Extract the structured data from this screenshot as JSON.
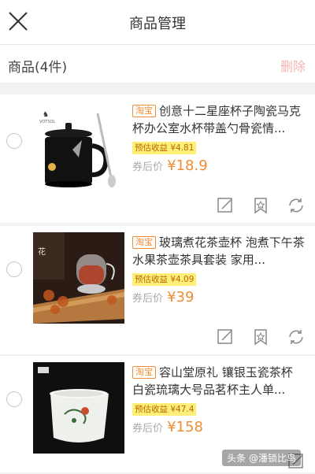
{
  "header": {
    "title": "商品管理"
  },
  "toolbar": {
    "count_label": "商品(4件)",
    "delete_label": "删除"
  },
  "products": [
    {
      "tag": "淘宝",
      "title": "创意十二星座杯子陶瓷马克杯办公室水杯带盖勺骨瓷情...",
      "earn": "预估收益 ¥4.81",
      "price_label": "券后价",
      "price": "¥18.9"
    },
    {
      "tag": "淘宝",
      "title": "玻璃煮花茶壶杯 泡煮下午茶 水果茶壶茶具套装 家用...",
      "earn": "预估收益 ¥4.09",
      "price_label": "券后价",
      "price": "¥39"
    },
    {
      "tag": "淘宝",
      "title": "容山堂原礼 镶银玉瓷茶杯 白瓷琉璃大号品茗杯主人单...",
      "earn": "预估收益 ¥47.4",
      "price_label": "券后价",
      "price": "¥158"
    }
  ],
  "watermark": "头条 @潘锁比鸟",
  "icons": {
    "close": "close-icon",
    "edit": "edit-icon",
    "bookmark": "bookmark-icon",
    "refresh": "refresh-icon"
  },
  "colors": {
    "accent": "#f08c34",
    "delete": "#f7b3b3",
    "earn_bg": "#ffef7a"
  }
}
